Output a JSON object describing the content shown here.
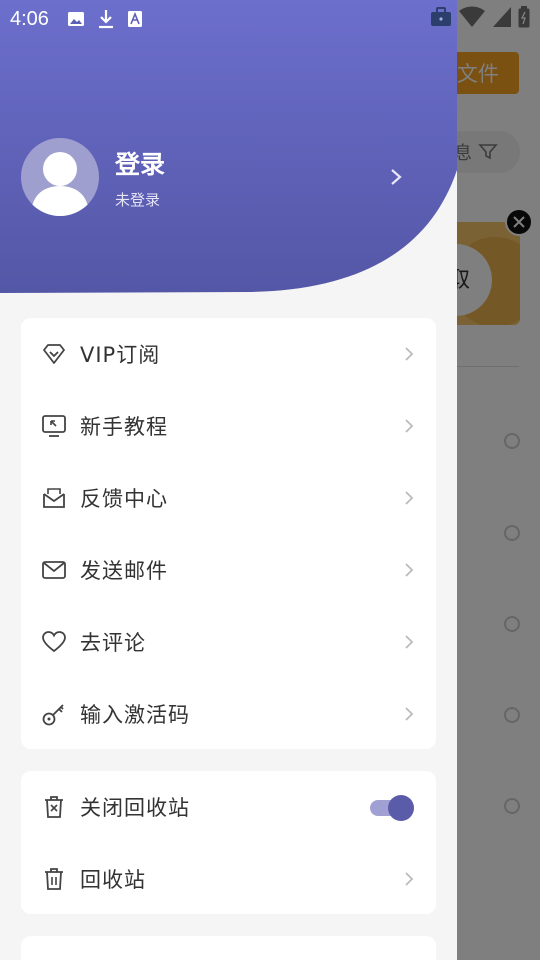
{
  "status_bar": {
    "time": "4:06"
  },
  "background_app": {
    "import_button_label": "文件",
    "filter_label": "息",
    "banner_text": "取"
  },
  "drawer": {
    "header": {
      "gradient_top": "#6c6fcc",
      "gradient_bottom": "#5456a6",
      "title": "登录",
      "subtitle": "未登录"
    },
    "menu_main": [
      {
        "label": "VIP订阅",
        "icon": "diamond-icon"
      },
      {
        "label": "新手教程",
        "icon": "tutorial-icon"
      },
      {
        "label": "反馈中心",
        "icon": "feedback-mail-icon"
      },
      {
        "label": "发送邮件",
        "icon": "envelope-icon"
      },
      {
        "label": "去评论",
        "icon": "heart-icon"
      },
      {
        "label": "输入激活码",
        "icon": "key-icon"
      }
    ],
    "menu_recycle": {
      "close_recycle_label": "关闭回收站",
      "close_recycle_enabled": true,
      "recycle_bin_label": "回收站"
    }
  },
  "colors": {
    "accent": "#5a5ba9",
    "bg_orange": "#f5a321"
  }
}
